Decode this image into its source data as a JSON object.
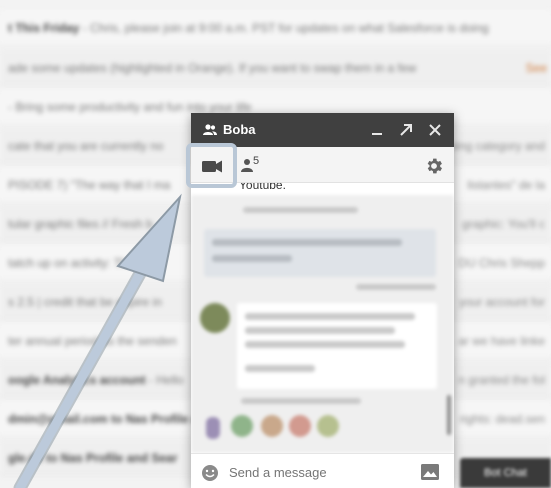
{
  "background": {
    "rows": [
      {
        "sender": "t This Friday",
        "text": " - Chris, please join at 9:00 a.m. PST for updates on what Salesforce is doing",
        "right": "",
        "accent": ""
      },
      {
        "sender": "",
        "text": "ade some updates (highlighted in Orange). If you want to swap them in a few",
        "right": "",
        "accent": "See"
      },
      {
        "sender": "",
        "text": " - Bring some productivity and fun into your life",
        "right": "",
        "accent": ""
      },
      {
        "sender": "",
        "text": "cate that you are currently no",
        "right": "ning category and",
        "accent": ""
      },
      {
        "sender": "",
        "text": "PISODE 7) \"The way that I ma",
        "right": "listantes\" de la",
        "accent": ""
      },
      {
        "sender": "",
        "text": "tular graphic files // Fresh b",
        "right": "graphic: You'll c",
        "accent": ""
      },
      {
        "sender": "",
        "text": "tatch up on activity: There w",
        "right": "DU Chris Shepp",
        "accent": ""
      },
      {
        "sender": "",
        "text": "s 2.5 | credit that be expire in",
        "right": "your account for",
        "accent": ""
      },
      {
        "sender": "",
        "text": "ter annual period as the senden",
        "right": "ar we have linke",
        "accent": ""
      },
      {
        "sender": "oogle Analytics account",
        "text": " - Hello",
        "right": "n granted the fol",
        "accent": ""
      },
      {
        "sender": "dmin@gmail.com to Nas Profile and Use",
        "text": "",
        "right": "rights: dead.sen",
        "accent": ""
      },
      {
        "sender": "gle.de to Nas Profile and Sear",
        "text": "",
        "right": "",
        "accent": ""
      }
    ]
  },
  "chat": {
    "title": "Boba",
    "participants_count": "5",
    "top_message_text": "Youtube.",
    "input_placeholder": "Send a message",
    "icons": {
      "title": "group-icon",
      "minimize": "minimize-icon",
      "popout": "popout-icon",
      "close": "close-icon",
      "video": "video-camera-icon",
      "people": "person-icon",
      "settings": "gear-icon",
      "emoji": "emoji-icon",
      "image": "image-icon"
    }
  },
  "chip": {
    "label": "Bot Chat"
  },
  "colors": {
    "header": "#404040",
    "highlight": "#b9c7d6",
    "arrow": "#b9c7d6"
  }
}
